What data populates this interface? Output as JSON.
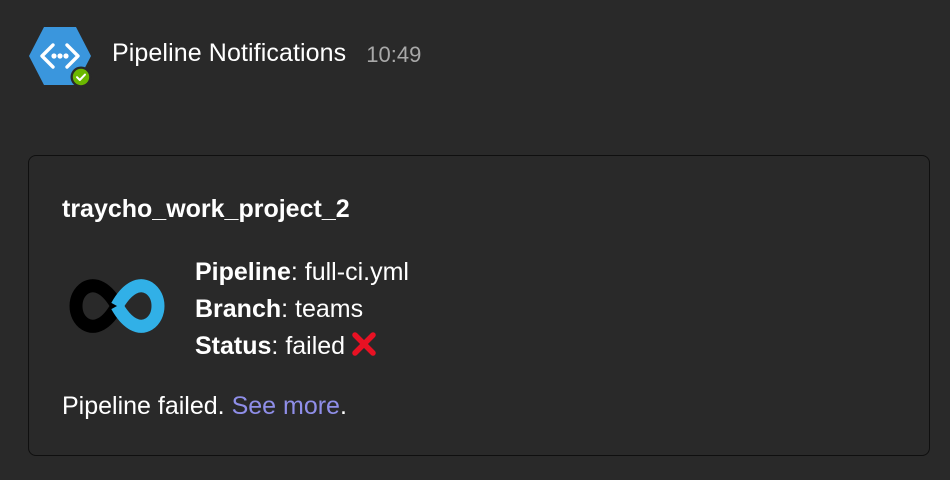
{
  "message": {
    "sender": "Pipeline Notifications",
    "time": "10:49",
    "avatar_icon": "azure-pipelines-icon",
    "presence": "available"
  },
  "card": {
    "title": "traycho_work_project_2",
    "logo_icon": "infinity-loop-logo-icon",
    "facts": [
      {
        "key": "Pipeline",
        "sep": ": ",
        "value": "full-ci.yml"
      },
      {
        "key": "Branch",
        "sep": ": ",
        "value": "teams"
      },
      {
        "key": "Status",
        "sep": ": ",
        "value": "failed"
      }
    ],
    "status_icon": "red-cross-mark-icon",
    "summary_text": "Pipeline failed. ",
    "link_text": "See more",
    "summary_end": "."
  },
  "colors": {
    "background": "#292929",
    "link": "#8f8ee8",
    "avatar_blue": "#3a96dd",
    "presence_green": "#6bb700",
    "logo_blue": "#31b0e7",
    "status_red": "#e81123"
  }
}
